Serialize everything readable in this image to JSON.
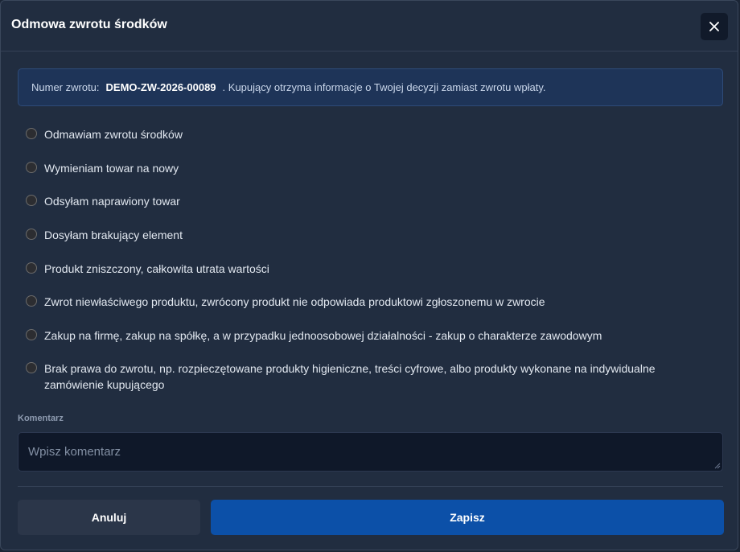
{
  "dialog": {
    "title": "Odmowa zwrotu środków",
    "close_label": "×"
  },
  "info": {
    "prefix": "Numer zwrotu:",
    "number": "DEMO-ZW-2026-00089",
    "message": ". Kupujący otrzyma informacje o Twojej decyzji zamiast zwrotu wpłaty."
  },
  "options": [
    {
      "label": "Odmawiam zwrotu środków",
      "selected": false
    },
    {
      "label": "Wymieniam towar na nowy",
      "selected": false
    },
    {
      "label": "Odsyłam naprawiony towar",
      "selected": false
    },
    {
      "label": "Dosyłam brakujący element",
      "selected": false
    },
    {
      "label": "Produkt zniszczony, całkowita utrata wartości",
      "selected": false
    },
    {
      "label": "Zwrot niewłaściwego produktu, zwrócony produkt nie odpowiada produktowi zgłoszonemu w zwrocie",
      "selected": false
    },
    {
      "label": "Zakup na firmę, zakup na spółkę, a w przypadku jednoosobowej działalności - zakup o charakterze zawodowym",
      "selected": false
    },
    {
      "label": "Brak prawa do zwrotu, np. rozpieczętowane produkty higieniczne, treści cyfrowe, albo produkty wykonane na indywidualne zamówienie kupującego",
      "selected": false
    }
  ],
  "comment": {
    "label": "Komentarz",
    "placeholder": "Wpisz komentarz",
    "value": ""
  },
  "buttons": {
    "cancel": "Anuluj",
    "save": "Zapisz"
  },
  "colors": {
    "primary": "#0c50a8",
    "background": "#212d40",
    "info_background": "#1e3458"
  }
}
